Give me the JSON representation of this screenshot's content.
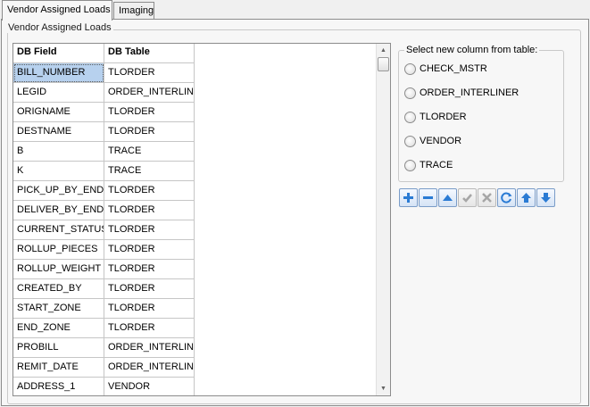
{
  "tabs": [
    {
      "label": "Vendor Assigned Loads",
      "active": true
    },
    {
      "label": "Imaging",
      "active": false
    }
  ],
  "group_title": "Vendor Assigned Loads",
  "table": {
    "columns": [
      "DB Field",
      "DB Table"
    ],
    "rows": [
      [
        "BILL_NUMBER",
        "TLORDER"
      ],
      [
        "LEGID",
        "ORDER_INTERLINE"
      ],
      [
        "ORIGNAME",
        "TLORDER"
      ],
      [
        "DESTNAME",
        "TLORDER"
      ],
      [
        "B",
        "TRACE"
      ],
      [
        "K",
        "TRACE"
      ],
      [
        "PICK_UP_BY_END",
        "TLORDER"
      ],
      [
        "DELIVER_BY_END",
        "TLORDER"
      ],
      [
        "CURRENT_STATUS",
        "TLORDER"
      ],
      [
        "ROLLUP_PIECES",
        "TLORDER"
      ],
      [
        "ROLLUP_WEIGHT",
        "TLORDER"
      ],
      [
        "CREATED_BY",
        "TLORDER"
      ],
      [
        "START_ZONE",
        "TLORDER"
      ],
      [
        "END_ZONE",
        "TLORDER"
      ],
      [
        "PROBILL",
        "ORDER_INTERLINE"
      ],
      [
        "REMIT_DATE",
        "ORDER_INTERLINE"
      ],
      [
        "ADDRESS_1",
        "VENDOR"
      ]
    ]
  },
  "selector": {
    "title": "Select new column from table:",
    "options": [
      "CHECK_MSTR",
      "ORDER_INTERLINER",
      "TLORDER",
      "VENDOR",
      "TRACE"
    ]
  },
  "toolbar": {
    "buttons": [
      {
        "name": "add-button",
        "icon": "plus-icon",
        "enabled": true
      },
      {
        "name": "remove-button",
        "icon": "minus-icon",
        "enabled": true
      },
      {
        "name": "move-up-button",
        "icon": "triangle-up-icon",
        "enabled": true
      },
      {
        "name": "confirm-button",
        "icon": "checkmark-icon",
        "enabled": false
      },
      {
        "name": "cancel-button",
        "icon": "x-icon",
        "enabled": false
      },
      {
        "name": "refresh-button",
        "icon": "refresh-icon",
        "enabled": true
      },
      {
        "name": "move-top-button",
        "icon": "arrow-up-icon",
        "enabled": true
      },
      {
        "name": "move-bottom-button",
        "icon": "arrow-down-icon",
        "enabled": true
      }
    ]
  },
  "colors": {
    "selection": "#b7d1ee",
    "button_blue": "#2a7bd4",
    "disabled_gray": "#a6a6a6"
  }
}
